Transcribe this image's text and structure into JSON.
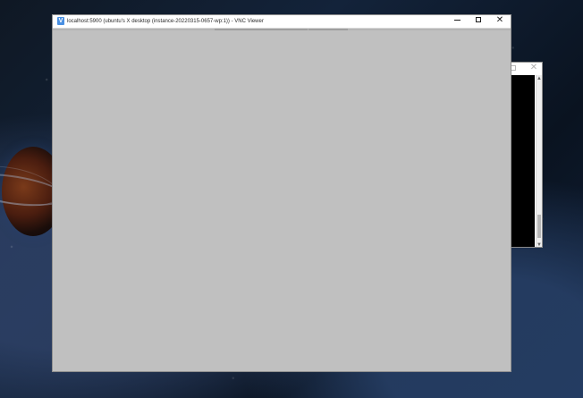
{
  "main_window": {
    "title": "localhost:5900 (ubuntu's X desktop (instance-20220315-0657-wp:1)) - VNC Viewer",
    "icon_name": "vnc-viewer-icon",
    "controls": {
      "minimize_icon": "minimize-icon",
      "maximize_icon": "maximize-icon",
      "close_icon": "close-icon"
    },
    "remote_background_color": "#c0c0c0"
  },
  "background_window": {
    "maximize_icon": "maximize-icon",
    "close_icon": "close-icon",
    "terminal_color": "#000000",
    "scroll_up_icon": "chevron-up-icon",
    "scroll_down_icon": "chevron-down-icon"
  },
  "desktop": {
    "wallpaper": "space-planet-wallpaper"
  }
}
